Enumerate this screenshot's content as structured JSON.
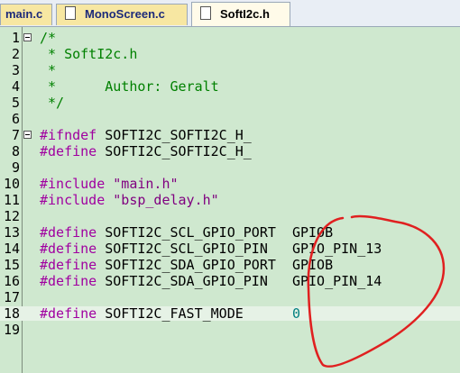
{
  "tabs": [
    {
      "label": "main.c",
      "active": false
    },
    {
      "label": "MonoScreen.c",
      "active": false
    },
    {
      "label": "SoftI2c.h",
      "active": true
    }
  ],
  "lines": [
    {
      "n": "1",
      "text": "/*",
      "cls": "cm",
      "fold": true
    },
    {
      "n": "2",
      "text": " * SoftI2c.h",
      "cls": "cm"
    },
    {
      "n": "3",
      "text": " *",
      "cls": "cm"
    },
    {
      "n": "4",
      "text": " *      Author: Geralt",
      "cls": "cm"
    },
    {
      "n": "5",
      "text": " */",
      "cls": "cm"
    },
    {
      "n": "6",
      "text": ""
    },
    {
      "n": "7",
      "kw": "#ifndef",
      "rest": " SOFTI2C_SOFTI2C_H_",
      "fold": true
    },
    {
      "n": "8",
      "kw": "#define",
      "rest": " SOFTI2C_SOFTI2C_H_"
    },
    {
      "n": "9",
      "text": ""
    },
    {
      "n": "10",
      "kw": "#include",
      "str": " \"main.h\""
    },
    {
      "n": "11",
      "kw": "#include",
      "str": " \"bsp_delay.h\""
    },
    {
      "n": "12",
      "text": ""
    },
    {
      "n": "13",
      "kw": "#define",
      "rest": " SOFTI2C_SCL_GPIO_PORT  GPIOB"
    },
    {
      "n": "14",
      "kw": "#define",
      "rest": " SOFTI2C_SCL_GPIO_PIN   GPIO_PIN_13"
    },
    {
      "n": "15",
      "kw": "#define",
      "rest": " SOFTI2C_SDA_GPIO_PORT  GPIOB"
    },
    {
      "n": "16",
      "kw": "#define",
      "rest": " SOFTI2C_SDA_GPIO_PIN   GPIO_PIN_14"
    },
    {
      "n": "17",
      "text": ""
    },
    {
      "n": "18",
      "kw": "#define",
      "rest": " SOFTI2C_FAST_MODE      ",
      "num": "0",
      "highlight": true
    },
    {
      "n": "19",
      "text": ""
    }
  ],
  "colors": {
    "background": "#cfe8cf",
    "keyword": "#a000a0",
    "comment": "#008000",
    "string": "#800080",
    "number": "#008080",
    "annotation": "#e02020"
  }
}
